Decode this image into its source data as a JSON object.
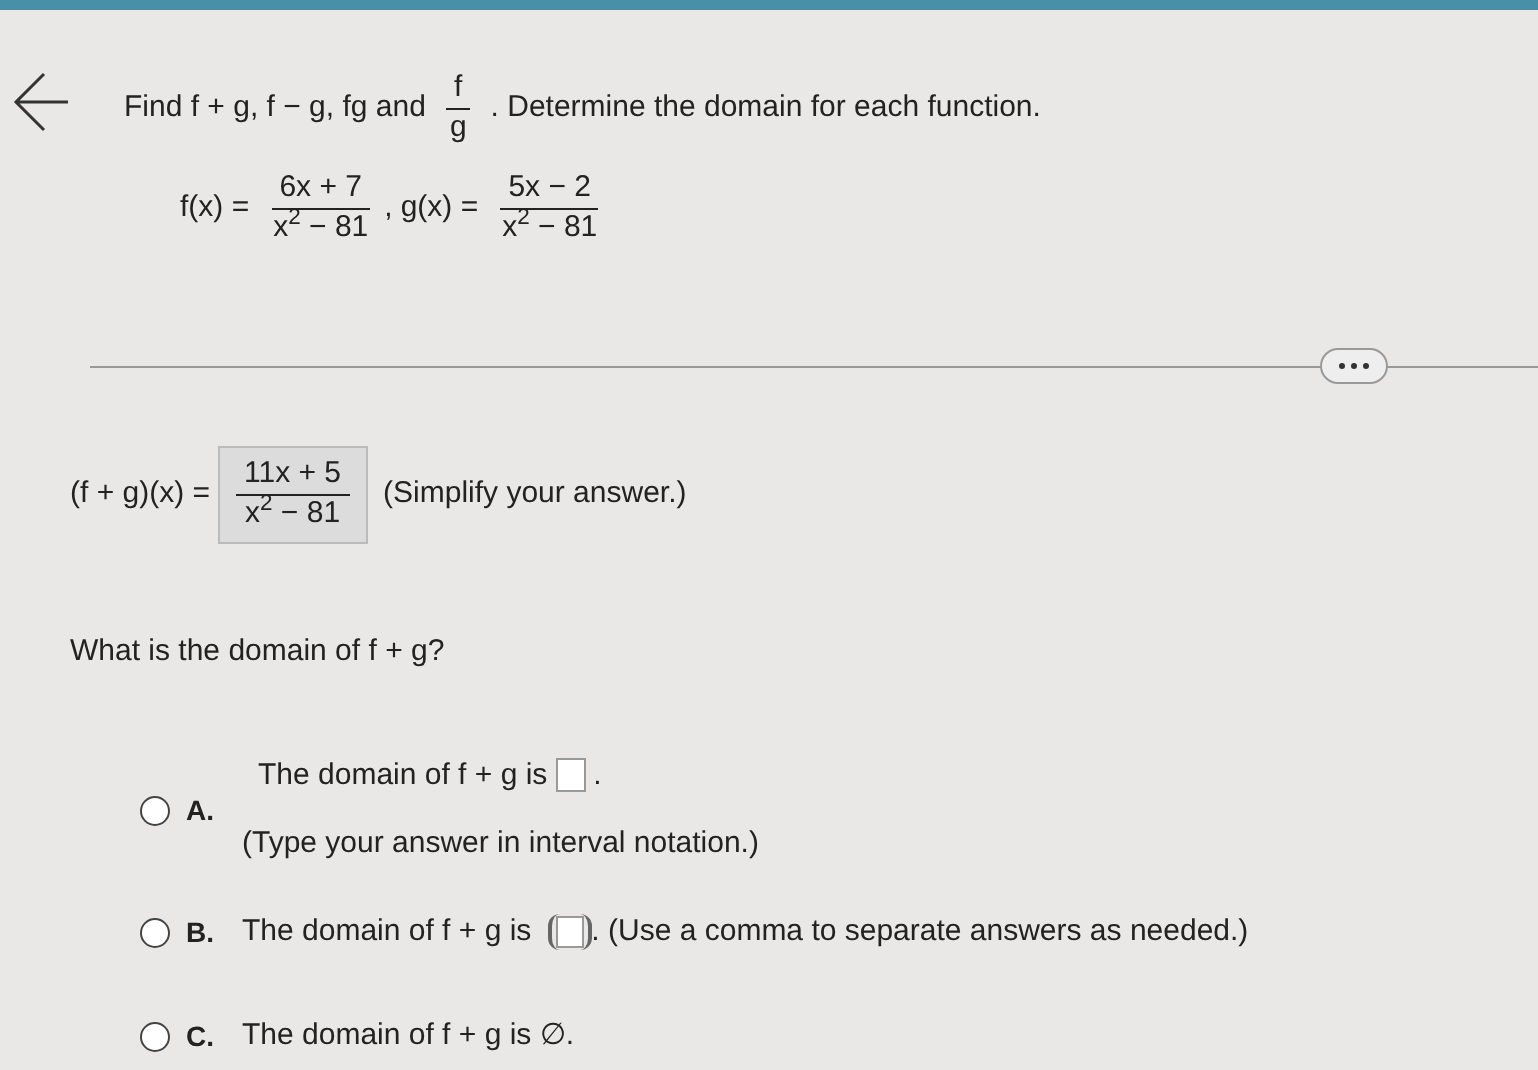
{
  "instruction": {
    "before": "Find f + g, f − g, fg and",
    "fraction": {
      "numerator": "f",
      "denominator": "g"
    },
    "after": ". Determine the domain for each function."
  },
  "functions": [
    {
      "lhs": "f(x) =",
      "numerator": "6x + 7",
      "denominator": "x$^{2}$ − 81",
      "separator": ","
    },
    {
      "lhs": "g(x) =",
      "numerator": "5x − 2",
      "denominator": "x$^{2}$ − 81"
    }
  ],
  "answer": {
    "lhs": "(f + g)(x) =",
    "numerator": "11x + 5",
    "denominator": "x$^{2}$ − 81",
    "note": "(Simplify your answer.)"
  },
  "question": "What is the domain of f + g?",
  "options": [
    {
      "letter": "A.",
      "kind": "blank",
      "text_before": "The domain of f + g is",
      "text_after": ".",
      "hint": "(Type your answer in interval notation.)",
      "selected": false
    },
    {
      "letter": "B.",
      "kind": "set",
      "text_before": "The domain of f + g is",
      "text_after": ". (Use a comma to separate answers as needed.)",
      "selected": false
    },
    {
      "letter": "C.",
      "kind": "text",
      "text_before": "The domain of f + g is ∅.",
      "selected": false
    }
  ]
}
